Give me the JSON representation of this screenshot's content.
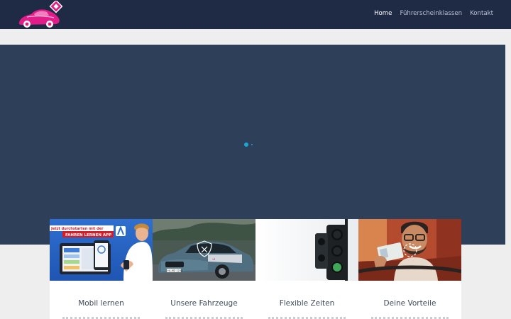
{
  "navbar": {
    "background": "#1f2b45",
    "logo_icon": "pink-car-logo",
    "links": [
      {
        "label": "Home",
        "active": true
      },
      {
        "label": "Führerscheinklassen",
        "active": false
      },
      {
        "label": "Kontakt",
        "active": false
      }
    ]
  },
  "hero": {
    "background": "#2e3f59",
    "slider_dot_color": "#19a7d4"
  },
  "cards": [
    {
      "title": "Mobil lernen",
      "image_banner_line1": "Jetzt durchstarten mit der",
      "image_banner_line2": "FAHREN LERNEN APP",
      "icon": "phone-app-image"
    },
    {
      "title": "Unsere Fahrzeuge",
      "icon": "car-photo-image",
      "plate": "HL-MZ 1234"
    },
    {
      "title": "Flexible Zeiten",
      "icon": "traffic-light-image"
    },
    {
      "title": "Deine Vorteile",
      "icon": "driver-license-photo-image"
    }
  ]
}
